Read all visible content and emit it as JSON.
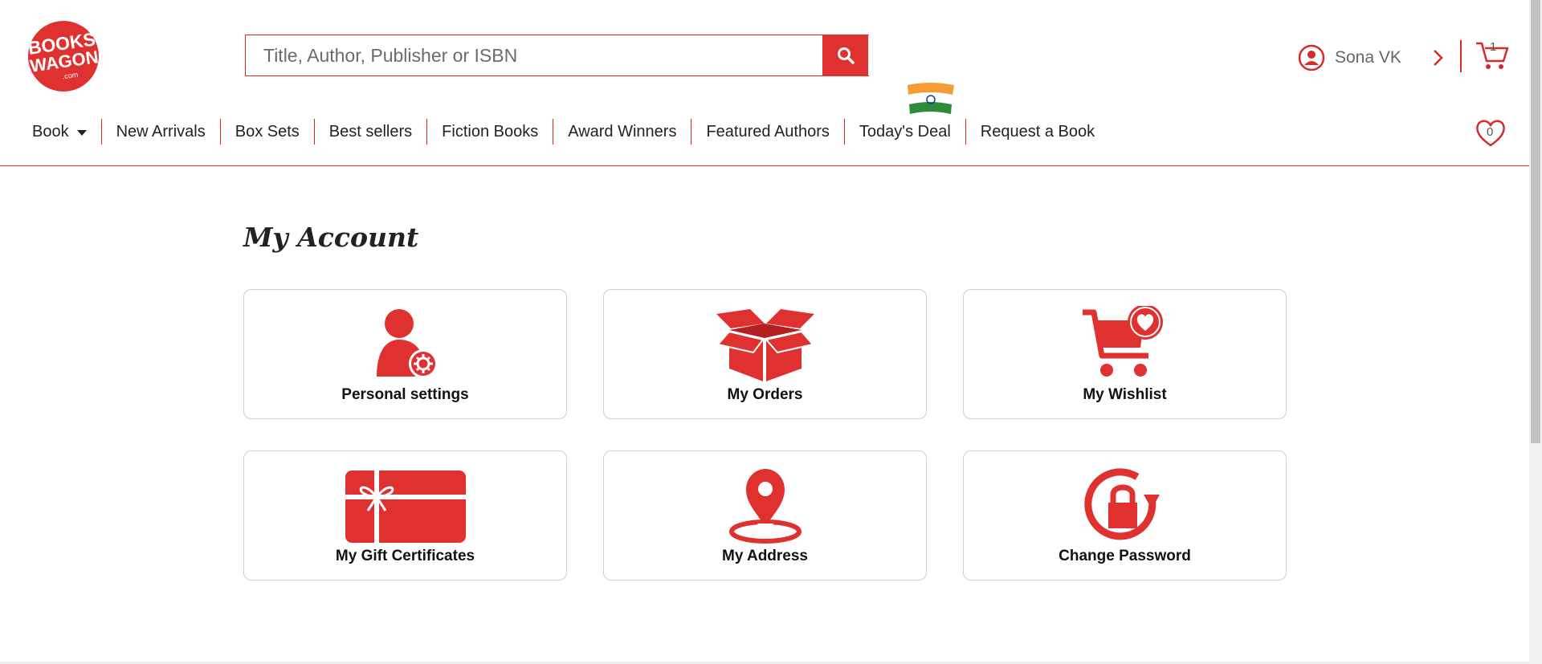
{
  "brand": {
    "logo_line1": "BOOKS",
    "logo_line2": "WAGON",
    "logo_line3": ".com",
    "color": "#e03131"
  },
  "search": {
    "placeholder": "Title, Author, Publisher or ISBN",
    "icon": "search-icon"
  },
  "user": {
    "name": "Sona VK",
    "icon": "user-circle-icon"
  },
  "cart": {
    "count": "1",
    "icon": "cart-icon"
  },
  "wishlist_header": {
    "count": "0",
    "icon": "heart-icon"
  },
  "nav": {
    "items": [
      {
        "label": "Book"
      },
      {
        "label": "New Arrivals"
      },
      {
        "label": "Box Sets"
      },
      {
        "label": "Best sellers"
      },
      {
        "label": "Fiction Books"
      },
      {
        "label": "Award Winners"
      },
      {
        "label": "Featured Authors"
      },
      {
        "label": "Today's Deal"
      },
      {
        "label": "Request a Book"
      }
    ]
  },
  "page": {
    "title": "My Account"
  },
  "cards": [
    {
      "label": "Personal settings",
      "icon": "user-settings-icon"
    },
    {
      "label": "My Orders",
      "icon": "open-box-icon"
    },
    {
      "label": "My Wishlist",
      "icon": "cart-heart-icon"
    },
    {
      "label": "My Gift Certificates",
      "icon": "gift-card-icon"
    },
    {
      "label": "My Address",
      "icon": "map-pin-icon"
    },
    {
      "label": "Change Password",
      "icon": "lock-refresh-icon"
    }
  ]
}
